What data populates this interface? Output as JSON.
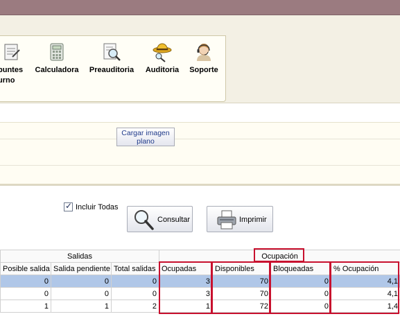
{
  "ribbon": {
    "items": [
      {
        "line1": "puntes",
        "line2": "urno",
        "icon": "notes-icon"
      },
      {
        "line1": "Calculadora",
        "line2": "",
        "icon": "calculator-icon"
      },
      {
        "line1": "Preauditoria",
        "line2": "",
        "icon": "magnifier-document-icon"
      },
      {
        "line1": "Auditoria",
        "line2": "",
        "icon": "detective-icon"
      },
      {
        "line1": "Soporte",
        "line2": "",
        "icon": "support-agent-icon"
      }
    ]
  },
  "plan": {
    "load_button": "Cargar imagen plano"
  },
  "filters": {
    "include_all_label": "Incluir Todas",
    "include_all_checked": true,
    "consult_label": "Consultar",
    "print_label": "Imprimir"
  },
  "table": {
    "groups": {
      "salidas": "Salidas",
      "ocupacion": "Ocupación"
    },
    "columns": [
      "Posible salida",
      "Salida pendiente",
      "Total salidas",
      "Ocupadas",
      "Disponibles",
      "Bloqueadas",
      "% Ocupación"
    ],
    "rows": [
      [
        "0",
        "0",
        "0",
        "3",
        "70",
        "0",
        "4,1"
      ],
      [
        "0",
        "0",
        "0",
        "3",
        "70",
        "0",
        "4,1"
      ],
      [
        "1",
        "1",
        "2",
        "1",
        "72",
        "0",
        "1,4"
      ]
    ],
    "selected_row": 0
  },
  "colors": {
    "titlebar": "#9b7b80",
    "selection": "#b0c7e8",
    "highlight_box": "#c8102e"
  }
}
